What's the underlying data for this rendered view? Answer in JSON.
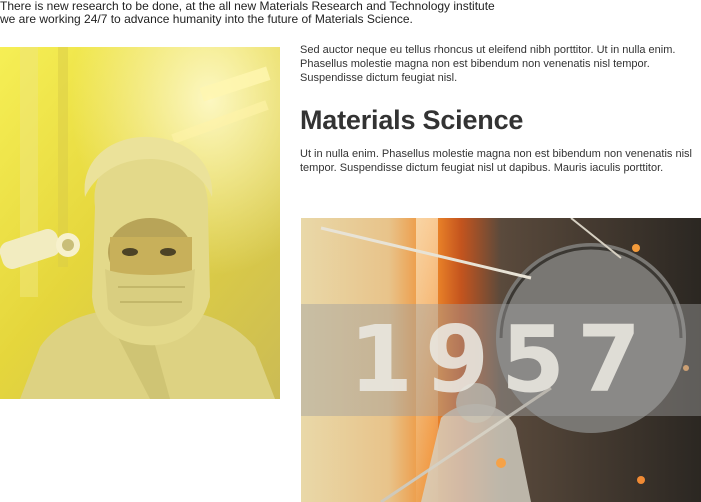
{
  "intro": {
    "line1": "There is new research to be done, at the all new Materials Research and Technology institute",
    "line2": "we are working 24/7 to advance humanity into the future of Materials Science."
  },
  "content": {
    "paragraph1": "Sed auctor neque eu tellus rhoncus ut eleifend nibh porttitor. Ut in nulla enim. Phasellus molestie magna non est bibendum non venenatis nisl tempor. Suspendisse dictum feugiat nisl.",
    "heading": "Materials Science",
    "paragraph2": "Ut in nulla enim. Phasellus molestie magna non est bibendum non venenatis nisl tempor. Suspendisse dictum feugiat nisl ut dapibus. Mauris iaculis porttitor."
  },
  "photo_right": {
    "year": "1957"
  },
  "colors": {
    "text": "#333333",
    "left_photo_tint": "#e8d93a",
    "right_photo_dark": "#2a2620",
    "right_photo_orange": "#e8762a"
  }
}
